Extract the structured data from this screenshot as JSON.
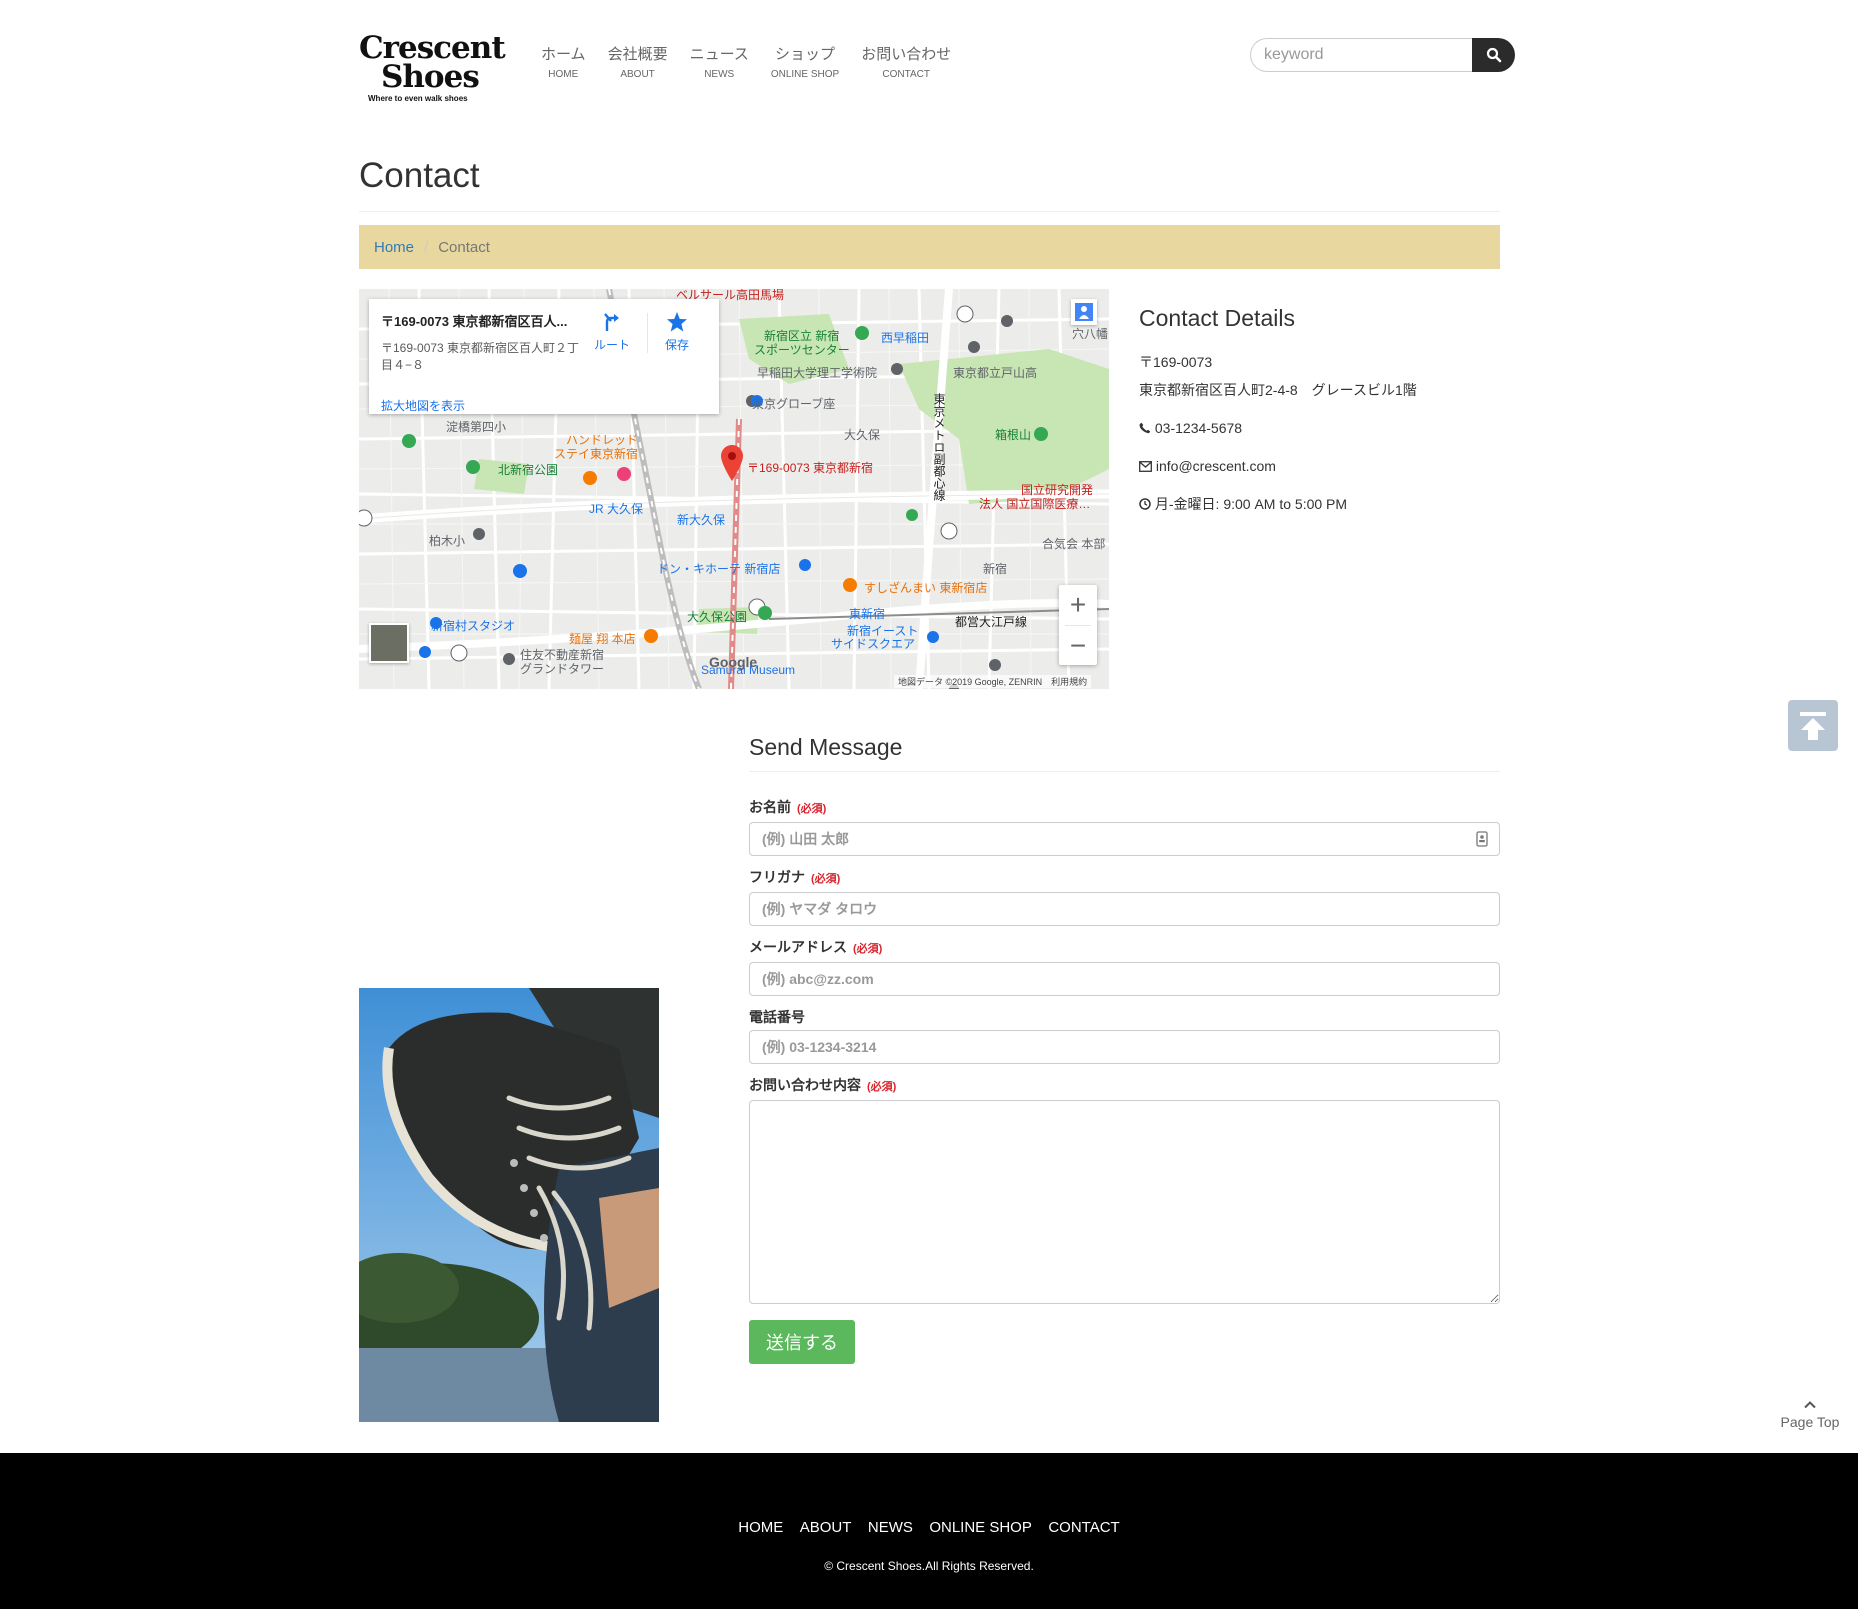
{
  "brand": {
    "name_line1": "Crescent",
    "name_line2": "Shoes",
    "tagline": "Where to even walk shoes"
  },
  "nav": [
    {
      "jp": "ホーム",
      "en": "HOME"
    },
    {
      "jp": "会社概要",
      "en": "ABOUT"
    },
    {
      "jp": "ニュース",
      "en": "NEWS"
    },
    {
      "jp": "ショップ",
      "en": "ONLINE SHOP"
    },
    {
      "jp": "お問い合わせ",
      "en": "CONTACT"
    }
  ],
  "search": {
    "placeholder": "keyword",
    "icon": "search-icon"
  },
  "page": {
    "title": "Contact"
  },
  "breadcrumb": {
    "home": "Home",
    "current": "Contact"
  },
  "map": {
    "card_title": "〒169-0073 東京都新宿区百人...",
    "card_address": "〒169-0073 東京都新宿区百人町２丁目４−８",
    "route_label": "ルート",
    "save_label": "保存",
    "enlarge_link": "拡大地図を表示",
    "pin_label": "〒169-0073 東京都新宿",
    "attribution": "地図データ ©2019 Google, ZENRIN　利用規約",
    "google": "Google",
    "zoom_in": "+",
    "zoom_out": "−",
    "places": [
      {
        "name": "ベルサール高田馬場",
        "color": "#c5221f"
      },
      {
        "name": "新宿区立 新宿",
        "color": "#188038"
      },
      {
        "name": "スポーツセンター",
        "color": "#188038"
      },
      {
        "name": "西早稲田",
        "color": "#1a73e8"
      },
      {
        "name": "早稲田大学理工学術院",
        "color": "#5f6368"
      },
      {
        "name": "東京都立戸山高",
        "color": "#5f6368"
      },
      {
        "name": "東京グローブ座",
        "color": "#5f6368"
      },
      {
        "name": "淀橋第四小",
        "color": "#5f6368"
      },
      {
        "name": "大久保",
        "color": "#5f6368"
      },
      {
        "name": "箱根山",
        "color": "#188038"
      },
      {
        "name": "ハンドレッド",
        "color": "#e8710a"
      },
      {
        "name": "ステイ東京新宿",
        "color": "#e8710a"
      },
      {
        "name": "北新宿公園",
        "color": "#188038"
      },
      {
        "name": "国立研究開発",
        "color": "#c5221f"
      },
      {
        "name": "法人 国立国際医療…",
        "color": "#c5221f"
      },
      {
        "name": "JR 大久保",
        "color": "#1a73e8"
      },
      {
        "name": "新大久保",
        "color": "#1a73e8"
      },
      {
        "name": "柏木小",
        "color": "#5f6368"
      },
      {
        "name": "合気会 本部",
        "color": "#5f6368"
      },
      {
        "name": "ドン・キホーテ 新宿店",
        "color": "#1a73e8"
      },
      {
        "name": "新宿",
        "color": "#5f6368"
      },
      {
        "name": "すしざんまい 東新宿店",
        "color": "#e8710a"
      },
      {
        "name": "大久保公園",
        "color": "#188038"
      },
      {
        "name": "東新宿",
        "color": "#1a73e8"
      },
      {
        "name": "都営大江戸線",
        "color": "#222222"
      },
      {
        "name": "新宿村スタジオ",
        "color": "#1a73e8"
      },
      {
        "name": "麺屋 翔 本店",
        "color": "#e8710a"
      },
      {
        "name": "新宿イースト",
        "color": "#1a73e8"
      },
      {
        "name": "サイドスクエア",
        "color": "#1a73e8"
      },
      {
        "name": "住友不動産新宿",
        "color": "#5f6368"
      },
      {
        "name": "グランドタワー",
        "color": "#5f6368"
      },
      {
        "name": "Samurai Museum",
        "color": "#1a73e8"
      },
      {
        "name": "東京メトロ副都心線",
        "color": "#222222"
      },
      {
        "name": "穴八幡",
        "color": "#5f6368"
      }
    ]
  },
  "contact_details": {
    "title": "Contact Details",
    "postal": "〒169-0073",
    "address": "東京都新宿区百人町2-4-8　グレースビル1階",
    "phone": "03-1234-5678",
    "email": "info@crescent.com",
    "hours": "月-金曜日: 9:00 AM to 5:00 PM"
  },
  "form": {
    "title": "Send Message",
    "required_text": "(必須)",
    "fields": [
      {
        "label": "お名前",
        "placeholder": "(例) 山田 太郎",
        "required": true
      },
      {
        "label": "フリガナ",
        "placeholder": "(例) ヤマダ タロウ",
        "required": true
      },
      {
        "label": "メールアドレス",
        "placeholder": "(例) abc@zz.com",
        "required": true
      },
      {
        "label": "電話番号",
        "placeholder": "(例) 03-1234-3214",
        "required": false
      },
      {
        "label": "お問い合わせ内容",
        "placeholder": "",
        "required": true
      }
    ],
    "submit": "送信する"
  },
  "page_top": {
    "label": "Page Top"
  },
  "footer": {
    "links": [
      "HOME",
      "ABOUT",
      "NEWS",
      "ONLINE SHOP",
      "CONTACT"
    ],
    "copyright": "© Crescent Shoes.All Rights Reserved."
  },
  "colors": {
    "breadcrumb_bg": "#e8d79f",
    "link": "#337ab7",
    "submit_bg": "#5cb85c",
    "required": "#d9232d",
    "footer_bg": "#000000",
    "search_btn": "#2b2b2b"
  }
}
